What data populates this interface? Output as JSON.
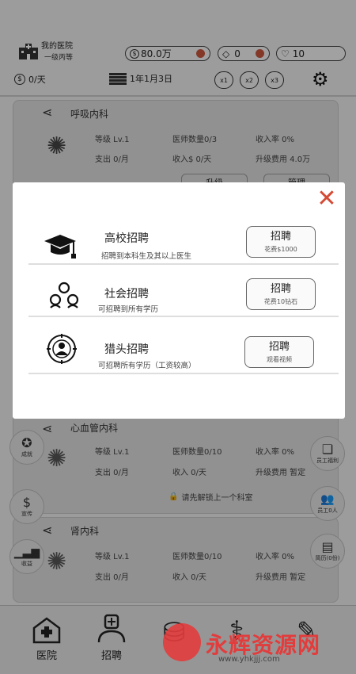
{
  "header": {
    "hospital_name": "我的医院",
    "hospital_level": "一级丙等",
    "money": "80.0万",
    "diamonds": "0",
    "hearts": "10",
    "daily_income": "0/天",
    "date": "1年1月3日",
    "speeds": [
      "x1",
      "x2",
      "x3"
    ]
  },
  "departments": [
    {
      "name": "呼吸内科",
      "level": "等级 Lv.1",
      "doctors": "医师数量0/3",
      "income_rate": "收入率 0%",
      "expense": "支出 0/月",
      "income": "收入$ 0/天",
      "upgrade_cost": "升级费用 4.0万",
      "btn_upgrade": "升级",
      "btn_manage": "管理"
    },
    {
      "name": "心血管内科",
      "level": "等级 Lv.1",
      "doctors": "医师数量0/10",
      "income_rate": "收入率 0%",
      "expense": "支出 0/月",
      "income": "收入 0/天",
      "upgrade_cost": "升级费用 暂定",
      "locked_note": "请先解锁上一个科室"
    },
    {
      "name": "肾内科",
      "level": "等级 Lv.1",
      "doctors": "医师数量0/10",
      "income_rate": "收入率 0%",
      "expense": "支出 0/月",
      "income": "收入 0/天",
      "upgrade_cost": "升级费用 暂定"
    }
  ],
  "side_left": [
    {
      "label": "成就",
      "icon": "medal-icon"
    },
    {
      "label": "宣传",
      "icon": "promo-icon"
    },
    {
      "label": "收益",
      "icon": "bar-chart-icon"
    }
  ],
  "side_right": [
    {
      "label": "员工福利",
      "icon": "gift-icon"
    },
    {
      "label": "员工0人",
      "icon": "staff-icon"
    },
    {
      "label": "简历(0份)",
      "icon": "resume-icon"
    }
  ],
  "recruit_modal": {
    "options": [
      {
        "title": "高校招聘",
        "desc": "招聘到本科生及其以上医生",
        "button": "招聘",
        "cost": "花费$1000",
        "icon": "graduation-cap-icon"
      },
      {
        "title": "社会招聘",
        "desc": "可招聘到所有学历",
        "button": "招聘",
        "cost": "花费10钻石",
        "icon": "people-group-icon"
      },
      {
        "title": "猎头招聘",
        "desc": "可招聘所有学历（工资较高）",
        "button": "招聘",
        "cost": "观看视频",
        "icon": "headhunter-icon"
      }
    ]
  },
  "bottom_nav": [
    {
      "label": "医院",
      "icon": "hospital-icon"
    },
    {
      "label": "招聘",
      "icon": "doctor-icon"
    },
    {
      "label": "",
      "icon": "moneybag-icon"
    },
    {
      "label": "",
      "icon": "lungs-icon"
    },
    {
      "label": "",
      "icon": "syringe-icon"
    }
  ],
  "watermark": {
    "text": "永辉资源网",
    "url": "www.yhkjjj.com"
  },
  "colors": {
    "accent_red": "#d54a35",
    "overlay": "#000000",
    "modal_bg": "#ffffff"
  }
}
